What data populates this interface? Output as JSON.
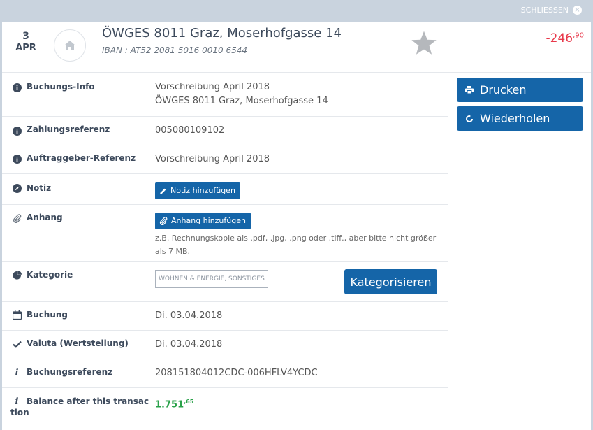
{
  "topbar": {
    "close_label": "SCHLIESSEN"
  },
  "header": {
    "day": "3",
    "month": "APR",
    "title": "ÖWGES 8011 Graz, Moserhofgasse 14",
    "iban": "IBAN : AT52 2081 5016 0010 6544",
    "amount_main": "-246",
    "amount_cents": ",90"
  },
  "actions": {
    "print_label": "Drucken",
    "repeat_label": "Wiederholen"
  },
  "rows": {
    "booking_info": {
      "label": "Buchungs-Info",
      "line1": "Vorschreibung April 2018",
      "line2": "ÖWGES 8011 Graz, Moserhofgasse 14"
    },
    "payment_ref": {
      "label": "Zahlungsreferenz",
      "value": "005080109102"
    },
    "orderer_ref": {
      "label": "Auftraggeber-Referenz",
      "value": "Vorschreibung April 2018"
    },
    "note": {
      "label": "Notiz",
      "button": "Notiz hinzufügen"
    },
    "attachment": {
      "label": "Anhang",
      "button": "Anhang hinzufügen",
      "hint": "z.B. Rechnungskopie als .pdf, .jpg, .png oder .tiff., aber bitte nicht größer als 7 MB."
    },
    "category": {
      "label": "Kategorie",
      "tag": "WOHNEN & ENERGIE, SONSTIGES",
      "button": "Kategorisieren"
    },
    "booking": {
      "label": "Buchung",
      "value": "Di. 03.04.2018"
    },
    "value_date": {
      "label": "Valuta (Wertstellung)",
      "value": "Di. 03.04.2018"
    },
    "booking_ref": {
      "label": "Buchungsreferenz",
      "value": "208151804012CDC-006HFLV4YCDC"
    },
    "balance": {
      "label_line1": "Balance after this transac",
      "label_line2": "tion",
      "value_main": "1.751",
      "value_cents": ",65"
    }
  },
  "colors": {
    "accent": "#1565a8",
    "negative": "#e8394b",
    "positive": "#2aa14a",
    "frame": "#c9d3de"
  }
}
